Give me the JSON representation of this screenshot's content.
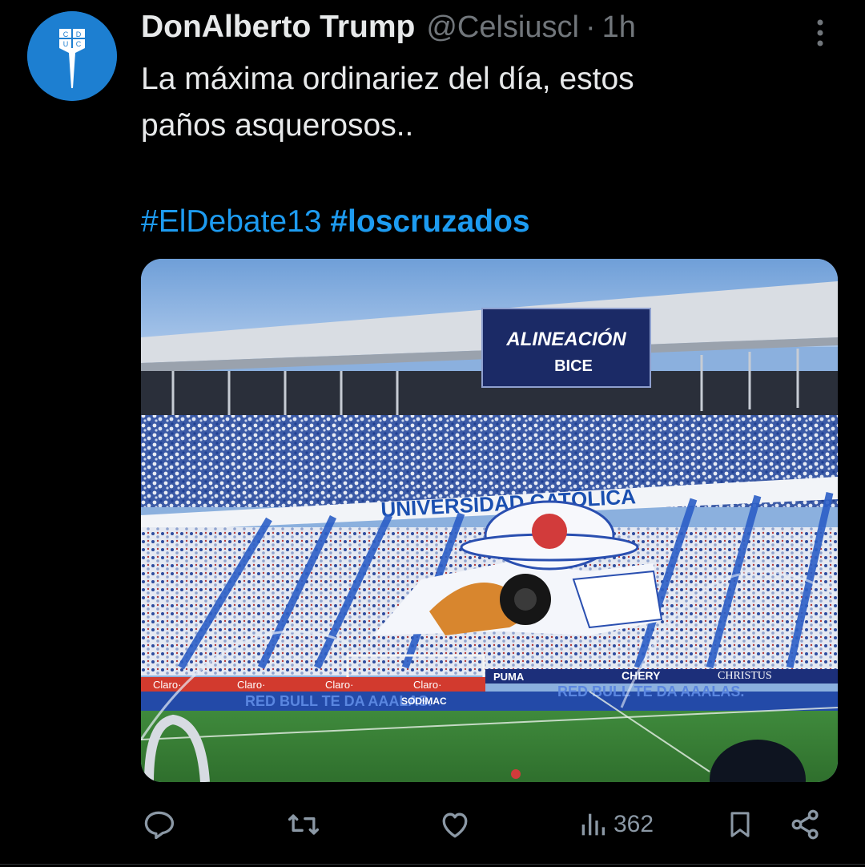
{
  "tweet": {
    "display_name": "DonAlberto Trump",
    "handle": "@Celsiuscl",
    "separator": "·",
    "time": "1h",
    "text_line1": "La máxima ordinariez del día, estos",
    "text_line2": "paños asquerosos..",
    "hashtag1": "#ElDebate13",
    "hashtag2": "#loscruzados"
  },
  "avatar": {
    "letters": [
      "C",
      "D",
      "U",
      "C"
    ],
    "color": "#1d7fd1"
  },
  "media": {
    "scoreboard_title": "ALINEACIÓN",
    "scoreboard_sponsor": "BICE",
    "banner_text": "UNIVERSIDAD CATÓLICA",
    "ad_claro": "Claro·",
    "ad_redbull": "RED BULL TE DA AAALAS.",
    "ad_sodimac": "SODIMAC",
    "ad_chery": "CHERY",
    "ad_christus": "CHRISTUS",
    "ad_puma": "PUMA"
  },
  "actions": {
    "reply_icon": "reply-icon",
    "retweet_icon": "retweet-icon",
    "like_icon": "like-icon",
    "views_icon": "views-icon",
    "views_count": "362",
    "bookmark_icon": "bookmark-icon",
    "share_icon": "share-icon"
  },
  "colors": {
    "accent": "#1d9bf0",
    "muted": "#71767b",
    "text": "#e7e9ea"
  }
}
